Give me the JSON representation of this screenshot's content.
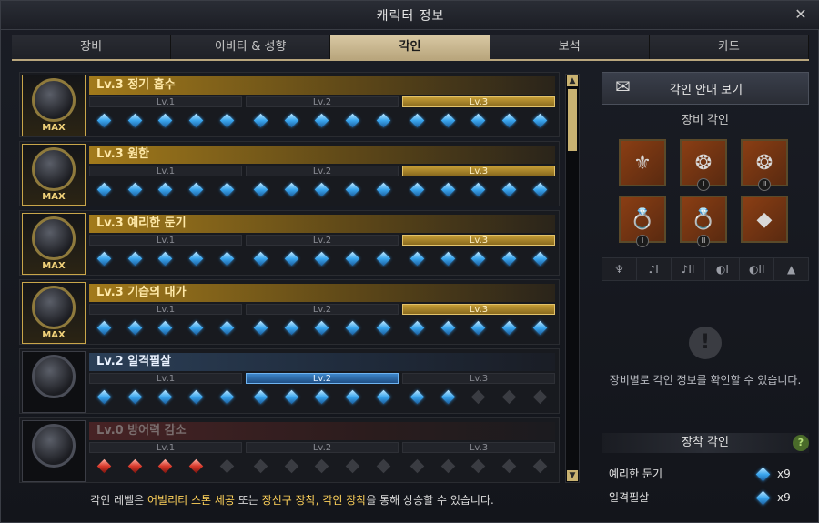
{
  "window": {
    "title": "캐릭터 정보",
    "close_icon": "close-icon"
  },
  "tabs": [
    {
      "label": "장비",
      "active": false
    },
    {
      "label": "아바타 & 성향",
      "active": false
    },
    {
      "label": "각인",
      "active": true
    },
    {
      "label": "보석",
      "active": false
    },
    {
      "label": "카드",
      "active": false
    }
  ],
  "engravings": [
    {
      "title": "Lv.3 정기 흡수",
      "style": "gold",
      "max": true,
      "max_label": "MAX",
      "active_level": 3,
      "levels": [
        {
          "label": "Lv.1",
          "gems": [
            "blue",
            "blue",
            "blue",
            "blue",
            "blue"
          ]
        },
        {
          "label": "Lv.2",
          "gems": [
            "blue",
            "blue",
            "blue",
            "blue",
            "blue"
          ]
        },
        {
          "label": "Lv.3",
          "gems": [
            "blue",
            "blue",
            "blue",
            "blue",
            "blue"
          ]
        }
      ]
    },
    {
      "title": "Lv.3 원한",
      "style": "gold",
      "max": true,
      "max_label": "MAX",
      "active_level": 3,
      "levels": [
        {
          "label": "Lv.1",
          "gems": [
            "blue",
            "blue",
            "blue",
            "blue",
            "blue"
          ]
        },
        {
          "label": "Lv.2",
          "gems": [
            "blue",
            "blue",
            "blue",
            "blue",
            "blue"
          ]
        },
        {
          "label": "Lv.3",
          "gems": [
            "blue",
            "blue",
            "blue",
            "blue",
            "blue"
          ]
        }
      ]
    },
    {
      "title": "Lv.3 예리한 둔기",
      "style": "gold",
      "max": true,
      "max_label": "MAX",
      "active_level": 3,
      "levels": [
        {
          "label": "Lv.1",
          "gems": [
            "blue",
            "blue",
            "blue",
            "blue",
            "blue"
          ]
        },
        {
          "label": "Lv.2",
          "gems": [
            "blue",
            "blue",
            "blue",
            "blue",
            "blue"
          ]
        },
        {
          "label": "Lv.3",
          "gems": [
            "blue",
            "blue",
            "blue",
            "blue",
            "blue"
          ]
        }
      ]
    },
    {
      "title": "Lv.3 기습의 대가",
      "style": "gold",
      "max": true,
      "max_label": "MAX",
      "active_level": 3,
      "levels": [
        {
          "label": "Lv.1",
          "gems": [
            "blue",
            "blue",
            "blue",
            "blue",
            "blue"
          ]
        },
        {
          "label": "Lv.2",
          "gems": [
            "blue",
            "blue",
            "blue",
            "blue",
            "blue"
          ]
        },
        {
          "label": "Lv.3",
          "gems": [
            "blue",
            "blue",
            "blue",
            "blue",
            "blue"
          ]
        }
      ]
    },
    {
      "title": "Lv.2 일격필살",
      "style": "blue",
      "max": false,
      "max_label": "",
      "active_level": 2,
      "levels": [
        {
          "label": "Lv.1",
          "gems": [
            "blue",
            "blue",
            "blue",
            "blue",
            "blue"
          ]
        },
        {
          "label": "Lv.2",
          "gems": [
            "blue",
            "blue",
            "blue",
            "blue",
            "blue"
          ]
        },
        {
          "label": "Lv.3",
          "gems": [
            "blue",
            "blue",
            "dark",
            "dark",
            "dark"
          ]
        }
      ]
    },
    {
      "title": "Lv.0 방어력 감소",
      "style": "gray",
      "max": false,
      "max_label": "",
      "active_level": 0,
      "levels": [
        {
          "label": "Lv.1",
          "gems": [
            "red",
            "red",
            "red",
            "red",
            "dark"
          ]
        },
        {
          "label": "Lv.2",
          "gems": [
            "dark",
            "dark",
            "dark",
            "dark",
            "dark"
          ]
        },
        {
          "label": "Lv.3",
          "gems": [
            "dark",
            "dark",
            "dark",
            "dark",
            "dark"
          ]
        }
      ]
    }
  ],
  "footer": {
    "prefix": "각인 레벨은 ",
    "hl1": "어빌리티 스톤 세공",
    "mid1": " 또는 ",
    "hl2": "장신구 장착, 각인 장착",
    "suffix": "을 통해 상승할 수 있습니다."
  },
  "side": {
    "guide_button": "각인 안내 보기",
    "equip_title": "장비 각인",
    "slots": [
      {
        "icon": "necklace-icon",
        "glyph": "⚜",
        "roman": ""
      },
      {
        "icon": "earring-icon",
        "glyph": "❂",
        "roman": "I"
      },
      {
        "icon": "earring-icon",
        "glyph": "❂",
        "roman": "II"
      },
      {
        "icon": "ring-icon",
        "glyph": "💍",
        "roman": "I"
      },
      {
        "icon": "ring-icon",
        "glyph": "💍",
        "roman": "II"
      },
      {
        "icon": "ability-stone-icon",
        "glyph": "◆",
        "roman": ""
      }
    ],
    "filters": [
      "♆",
      "♪I",
      "♪II",
      "◐I",
      "◐II",
      "▲"
    ],
    "info_text": "장비별로 각인 정보를 확인할 수 있습니다.",
    "equipped_title": "장착 각인",
    "equipped": [
      {
        "name": "예리한 둔기",
        "count": "x9"
      },
      {
        "name": "일격필살",
        "count": "x9"
      }
    ],
    "help_label": "?"
  },
  "colors": {
    "accent_gold": "#c9a64a",
    "tab_active": "#d9c9a4",
    "gem_blue": "#3aa6ee",
    "gem_red": "#d8392b",
    "highlight": "#ffd25a"
  }
}
